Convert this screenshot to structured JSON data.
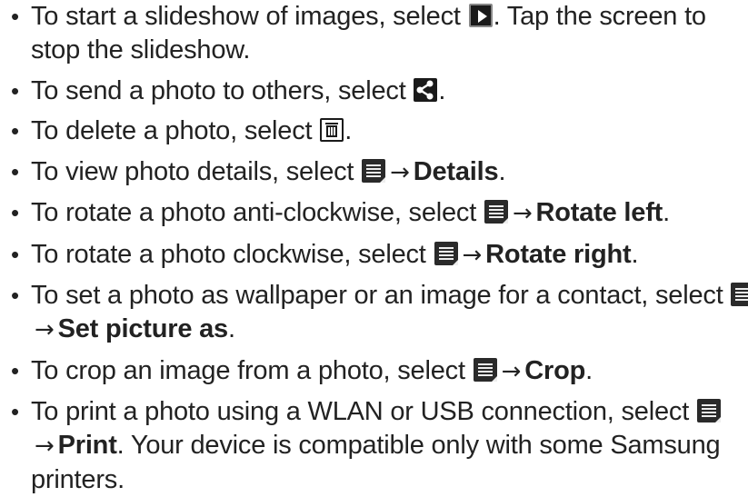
{
  "items": [
    {
      "pre": "To start a slideshow of images, select ",
      "icon": "play-icon",
      "post": ". Tap the screen to stop the slideshow."
    },
    {
      "pre": "To send a photo to others, select ",
      "icon": "share-icon",
      "post": "."
    },
    {
      "pre": "To delete a photo, select ",
      "icon": "delete-icon",
      "post": "."
    },
    {
      "pre": "To view photo details, select ",
      "icon": "menu-icon",
      "arrow": "→",
      "bold": "Details",
      "post": "."
    },
    {
      "pre": "To rotate a photo anti-clockwise, select ",
      "icon": "menu-icon",
      "arrow": "→",
      "bold": "Rotate left",
      "post": "."
    },
    {
      "pre": "To rotate a photo clockwise, select ",
      "icon": "menu-icon",
      "arrow": "→",
      "bold": "Rotate right",
      "post": "."
    },
    {
      "pre": "To set a photo as wallpaper or an image for a contact, select ",
      "icon": "menu-icon",
      "arrow": "→",
      "bold": "Set picture as",
      "post": "."
    },
    {
      "pre": "To crop an image from a photo, select ",
      "icon": "menu-icon",
      "arrow": "→",
      "bold": "Crop",
      "post": "."
    },
    {
      "pre": "To print a photo using a WLAN or USB connection, select ",
      "icon": "menu-icon",
      "arrow": "→",
      "bold": "Print",
      "post": ". Your device is compatible only with some Samsung printers."
    }
  ],
  "bullet_char": "•"
}
